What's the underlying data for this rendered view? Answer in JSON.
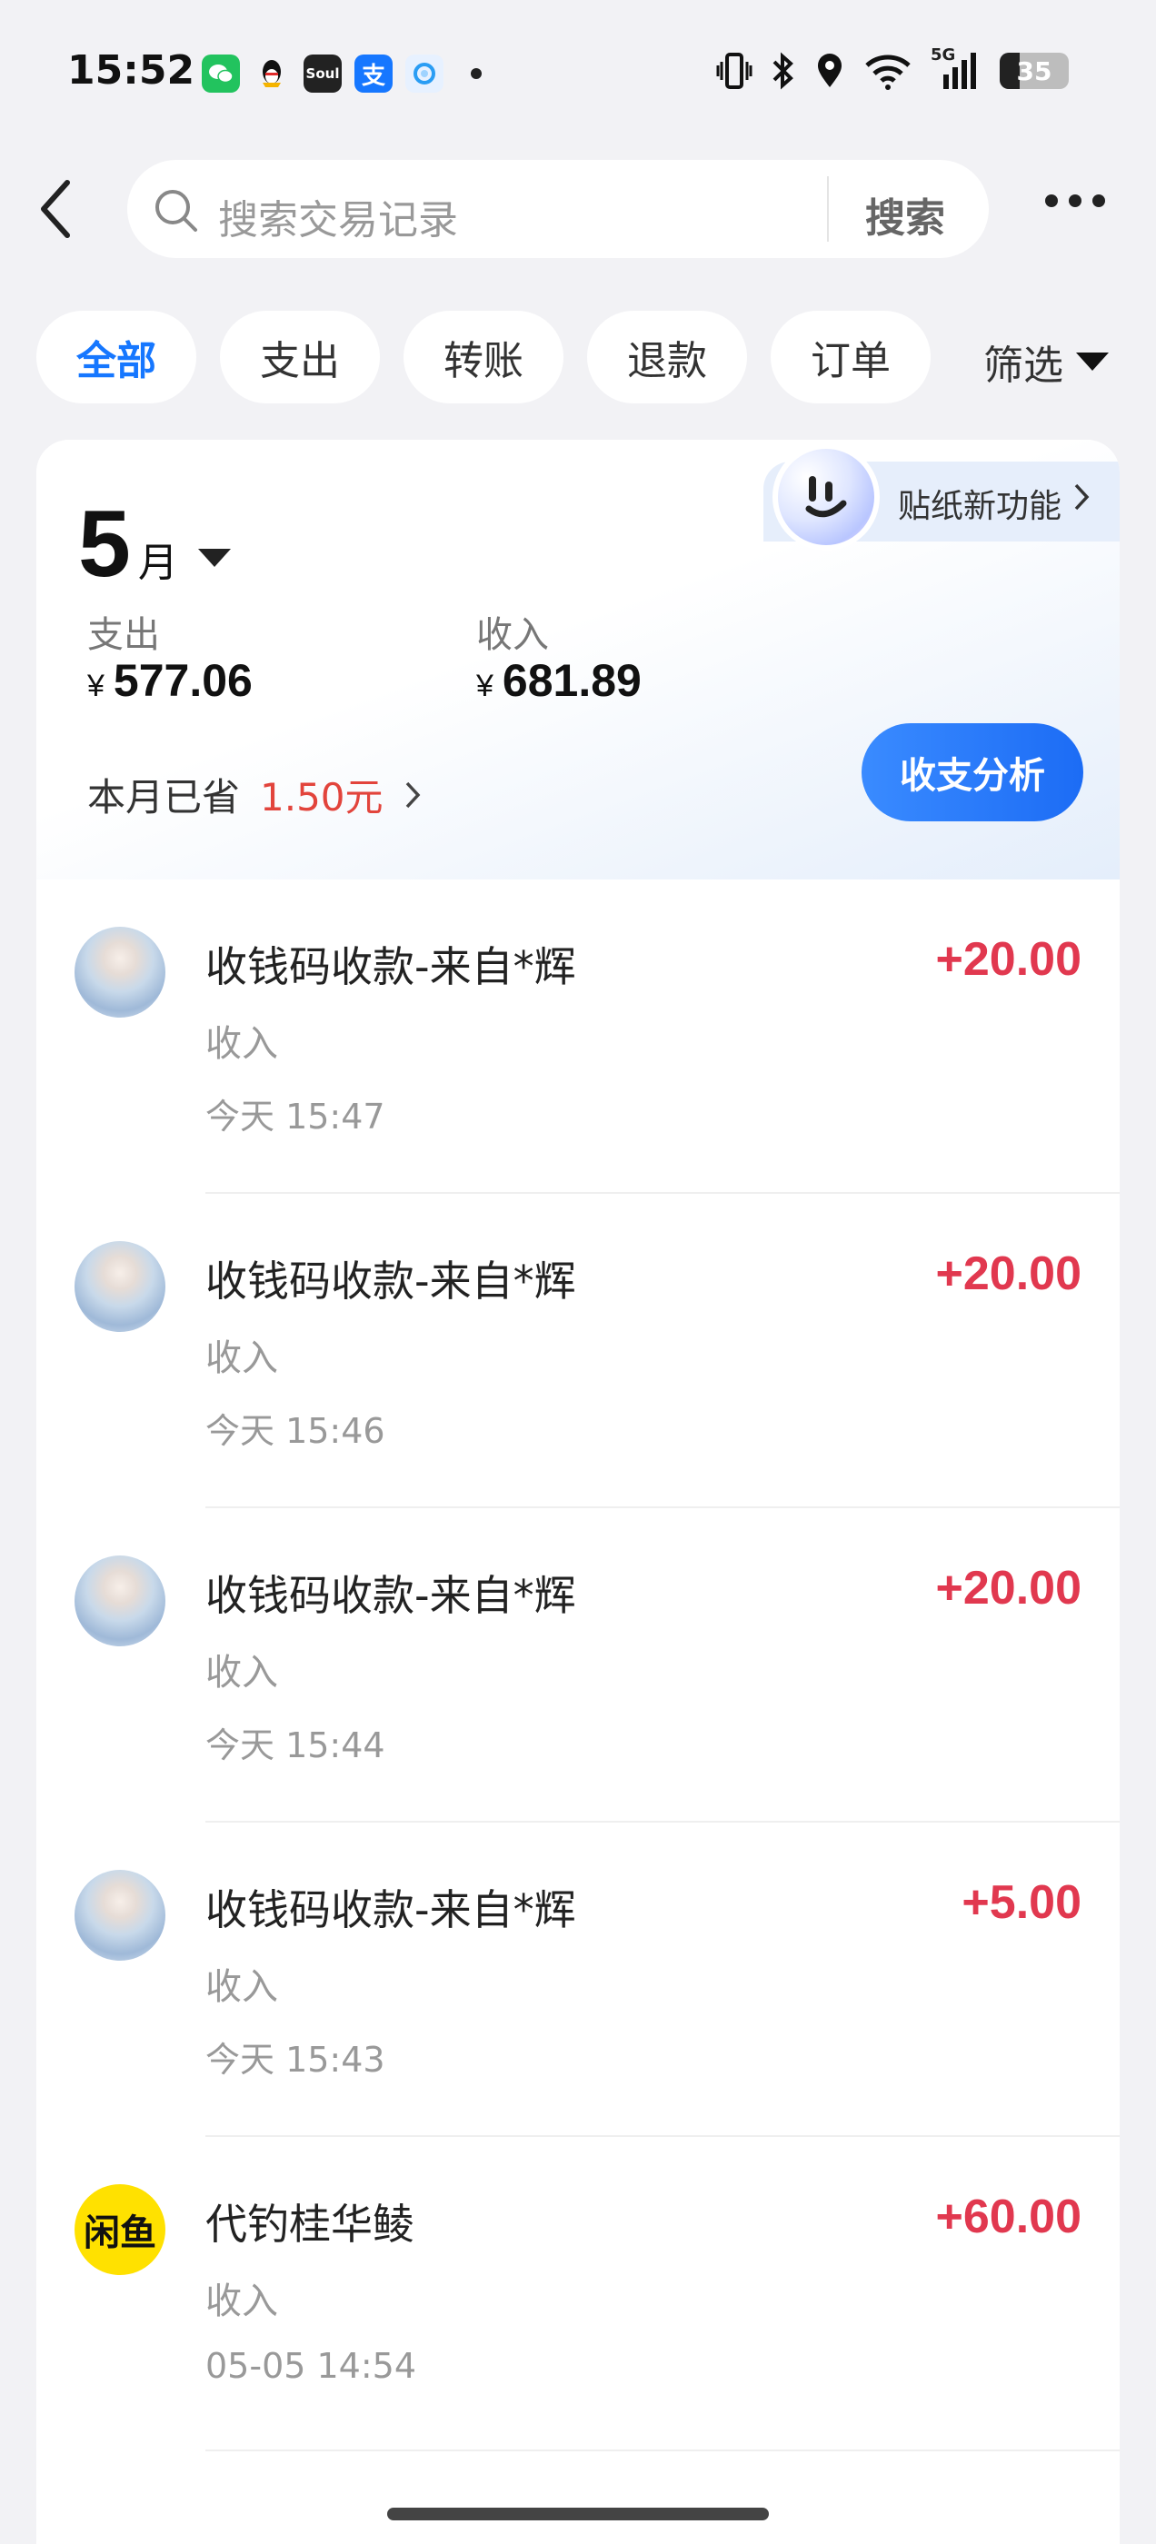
{
  "status_bar": {
    "time": "15:52",
    "apps": [
      {
        "name": "wechat-icon",
        "color": "#22c35e",
        "glyph": "✉"
      },
      {
        "name": "qq-icon",
        "color": "#ffffff",
        "glyph": "🐧"
      },
      {
        "name": "soul-icon",
        "color": "#222222",
        "glyph": "Soul"
      },
      {
        "name": "alipay-icon",
        "color": "#1677ff",
        "glyph": "支"
      },
      {
        "name": "browser-icon",
        "color": "#e7f1ff",
        "glyph": "◐"
      }
    ],
    "network": "5G",
    "battery": "35"
  },
  "search": {
    "placeholder": "搜索交易记录",
    "button_label": "搜索"
  },
  "filters": {
    "chips": [
      "全部",
      "支出",
      "转账",
      "退款",
      "订单"
    ],
    "active": "全部",
    "filter_label": "筛选"
  },
  "summary": {
    "sticker_label": "贴纸新功能",
    "month": "5",
    "month_unit": "月",
    "expense_label": "支出",
    "expense_currency": "¥",
    "expense_value": "577.06",
    "income_label": "收入",
    "income_currency": "¥",
    "income_value": "681.89",
    "saved_label": "本月已省",
    "saved_amount": "1.50元",
    "analysis_button": "收支分析"
  },
  "transactions": [
    {
      "title": "收钱码收款-来自*辉",
      "type": "收入",
      "time": "今天 15:47",
      "amount": "+20.00",
      "avatar": "photo"
    },
    {
      "title": "收钱码收款-来自*辉",
      "type": "收入",
      "time": "今天 15:46",
      "amount": "+20.00",
      "avatar": "photo"
    },
    {
      "title": "收钱码收款-来自*辉",
      "type": "收入",
      "time": "今天 15:44",
      "amount": "+20.00",
      "avatar": "photo"
    },
    {
      "title": "收钱码收款-来自*辉",
      "type": "收入",
      "time": "今天 15:43",
      "amount": "+5.00",
      "avatar": "photo"
    },
    {
      "title": "代钓桂华鲮",
      "type": "收入",
      "time": "05-05 14:54",
      "amount": "+60.00",
      "avatar": "闲鱼"
    }
  ],
  "colors": {
    "accent": "#1677ff",
    "income_amount": "#e1384f",
    "saved_amount": "#e2443c",
    "background": "#f2f2f5"
  }
}
